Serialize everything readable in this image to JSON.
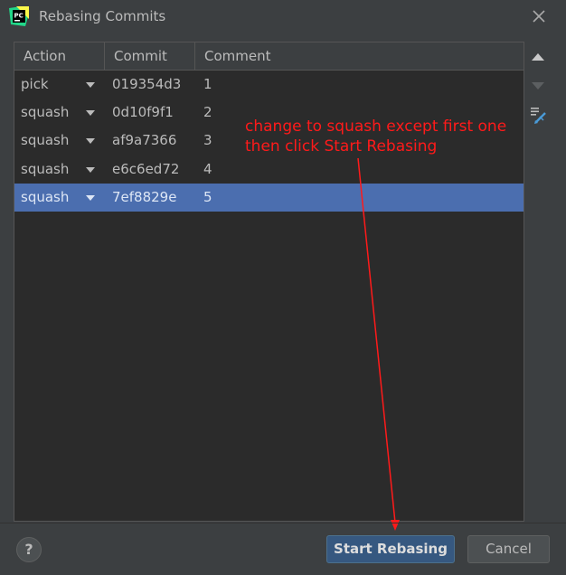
{
  "window": {
    "title": "Rebasing Commits",
    "app_icon_text": "PC"
  },
  "table": {
    "columns": [
      "Action",
      "Commit",
      "Comment"
    ],
    "rows": [
      {
        "action": "pick",
        "commit": "019354d3",
        "comment": "1",
        "selected": false
      },
      {
        "action": "squash",
        "commit": "0d10f9f1",
        "comment": "2",
        "selected": false
      },
      {
        "action": "squash",
        "commit": "af9a7366",
        "comment": "3",
        "selected": false
      },
      {
        "action": "squash",
        "commit": "e6c6ed72",
        "comment": "4",
        "selected": false
      },
      {
        "action": "squash",
        "commit": "7ef8829e",
        "comment": "5",
        "selected": true
      }
    ]
  },
  "side_toolbar": {
    "icons": [
      "move-up-icon",
      "move-down-icon",
      "edit-message-icon"
    ]
  },
  "annotation": {
    "line1": "change to squash except first one",
    "line2": "then click Start Rebasing",
    "color": "#ff1a1a"
  },
  "footer": {
    "help_label": "?",
    "start_label": "Start Rebasing",
    "cancel_label": "Cancel"
  },
  "colors": {
    "dialog_bg": "#3c3f41",
    "table_bg": "#2b2b2b",
    "selection": "#4b6eaf",
    "primary_button": "#365880"
  }
}
